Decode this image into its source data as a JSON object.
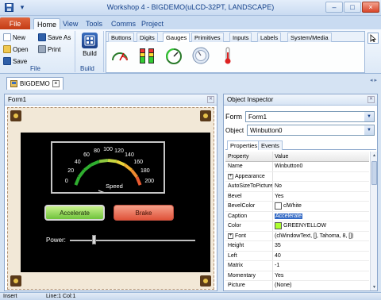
{
  "window": {
    "title": "Workshop 4 - BIGDEMO(uLCD-32PT, LANDSCAPE)",
    "minimize_glyph": "–",
    "maximize_glyph": "□",
    "close_glyph": "×"
  },
  "ribbon": {
    "file_tab": "File",
    "tabs": [
      "Home",
      "View",
      "Tools",
      "Comms",
      "Project"
    ],
    "active_tab": "Home",
    "file_group": {
      "new": "New",
      "open": "Open",
      "save": "Save",
      "save_as": "Save As",
      "print": "Print",
      "label": "File"
    },
    "build_group": {
      "button": "Build",
      "label": "Build"
    }
  },
  "palette": {
    "tabs": [
      "Buttons",
      "Digits",
      "Gauges",
      "Primitives",
      "Inputs",
      "Labels",
      "System/Media"
    ],
    "active_tab": "Gauges",
    "icons": [
      "angular-meter-icon",
      "gauge-bars-icon",
      "cool-gauge-icon",
      "knob-icon",
      "thermometer-icon"
    ]
  },
  "doc_tab": {
    "label": "BIGDEMO",
    "close": "×"
  },
  "form_panel": {
    "title": "Form1",
    "meter": {
      "ticks": [
        "0",
        "20",
        "40",
        "60",
        "80",
        "100",
        "120",
        "140",
        "160",
        "180",
        "200"
      ],
      "label": "Speed"
    },
    "accelerate_label": "Accelerate",
    "brake_label": "Brake",
    "power_label": "Power:"
  },
  "inspector": {
    "title": "Object Inspector",
    "form_label": "Form",
    "form_value": "Form1",
    "object_label": "Object",
    "object_value": "Winbutton0",
    "tabs": [
      "Properties",
      "Events"
    ],
    "active_tab": "Properties",
    "col_property": "Property",
    "col_value": "Value",
    "rows": [
      {
        "name": "Name",
        "value": "Winbutton0"
      },
      {
        "name": "Appearance",
        "value": "",
        "expand": "+"
      },
      {
        "name": "AutoSizeToPicture",
        "value": "No"
      },
      {
        "name": "Bevel",
        "value": "Yes"
      },
      {
        "name": "BevelColor",
        "value": "clWhite",
        "swatch": "#ffffff"
      },
      {
        "name": "Caption",
        "value": "Accelerate",
        "selected": true
      },
      {
        "name": "Color",
        "value": "GREENYELLOW",
        "swatch": "#adff2f"
      },
      {
        "name": "Font",
        "value": "(clWindowText, [], Tahoma, 8, [])",
        "expand": "+"
      },
      {
        "name": "Height",
        "value": "35"
      },
      {
        "name": "Left",
        "value": "40"
      },
      {
        "name": "Matrix",
        "value": "-1"
      },
      {
        "name": "Momentary",
        "value": "Yes"
      },
      {
        "name": "Picture",
        "value": "(None)"
      }
    ]
  },
  "statusbar": {
    "mode": "Insert",
    "position": "Line:1 Col:1"
  },
  "colors": {
    "accent": "#15428b",
    "accelerate": "#8fd854",
    "brake": "#e9735a",
    "selection": "#3168c4"
  }
}
